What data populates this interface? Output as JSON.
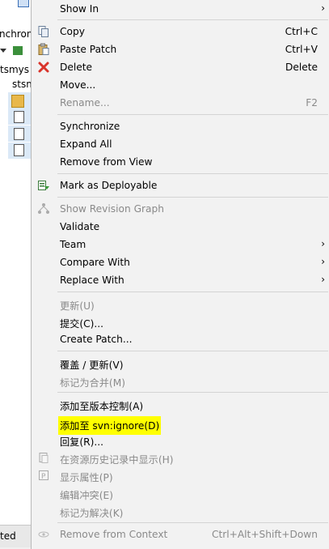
{
  "background": {
    "texts": [
      "nchroni",
      "tsmys",
      "stsm"
    ],
    "status_text": "ted"
  },
  "menu": {
    "items": [
      {
        "label": "Show In",
        "accel": "",
        "submenu": true,
        "disabled": false,
        "icon": "",
        "highlight": false
      },
      {
        "label": "Copy",
        "accel": "Ctrl+C",
        "submenu": false,
        "disabled": false,
        "icon": "copy-icon",
        "highlight": false
      },
      {
        "label": "Paste Patch",
        "accel": "Ctrl+V",
        "submenu": false,
        "disabled": false,
        "icon": "paste-icon",
        "highlight": false
      },
      {
        "label": "Delete",
        "accel": "Delete",
        "submenu": false,
        "disabled": false,
        "icon": "delete-icon",
        "highlight": false
      },
      {
        "label": "Move...",
        "accel": "",
        "submenu": false,
        "disabled": false,
        "icon": "",
        "highlight": false
      },
      {
        "label": "Rename...",
        "accel": "F2",
        "submenu": false,
        "disabled": true,
        "icon": "",
        "highlight": false
      },
      {
        "label": "Synchronize",
        "accel": "",
        "submenu": false,
        "disabled": false,
        "icon": "",
        "highlight": false
      },
      {
        "label": "Expand All",
        "accel": "",
        "submenu": false,
        "disabled": false,
        "icon": "",
        "highlight": false
      },
      {
        "label": "Remove from View",
        "accel": "",
        "submenu": false,
        "disabled": false,
        "icon": "",
        "highlight": false
      },
      {
        "label": "Mark as Deployable",
        "accel": "",
        "submenu": false,
        "disabled": false,
        "icon": "deploy-icon",
        "highlight": false
      },
      {
        "label": "Show Revision Graph",
        "accel": "",
        "submenu": false,
        "disabled": true,
        "icon": "revision-graph-icon",
        "highlight": false
      },
      {
        "label": "Validate",
        "accel": "",
        "submenu": false,
        "disabled": false,
        "icon": "",
        "highlight": false
      },
      {
        "label": "Team",
        "accel": "",
        "submenu": true,
        "disabled": false,
        "icon": "",
        "highlight": false
      },
      {
        "label": "Compare With",
        "accel": "",
        "submenu": true,
        "disabled": false,
        "icon": "",
        "highlight": false
      },
      {
        "label": "Replace With",
        "accel": "",
        "submenu": true,
        "disabled": false,
        "icon": "",
        "highlight": false
      },
      {
        "label": "更新(U)",
        "accel": "",
        "submenu": false,
        "disabled": true,
        "icon": "",
        "highlight": false
      },
      {
        "label": "提交(C)...",
        "accel": "",
        "submenu": false,
        "disabled": false,
        "icon": "",
        "highlight": false
      },
      {
        "label": "Create Patch...",
        "accel": "",
        "submenu": false,
        "disabled": false,
        "icon": "",
        "highlight": false
      },
      {
        "label": "覆盖 / 更新(V)",
        "accel": "",
        "submenu": false,
        "disabled": false,
        "icon": "",
        "highlight": false
      },
      {
        "label": "标记为合并(M)",
        "accel": "",
        "submenu": false,
        "disabled": true,
        "icon": "",
        "highlight": false
      },
      {
        "label": "添加至版本控制(A)",
        "accel": "",
        "submenu": false,
        "disabled": false,
        "icon": "",
        "highlight": false
      },
      {
        "label": "添加至 svn:ignore(D)",
        "accel": "",
        "submenu": false,
        "disabled": false,
        "icon": "",
        "highlight": true
      },
      {
        "label": "回复(R)...",
        "accel": "",
        "submenu": false,
        "disabled": false,
        "icon": "",
        "highlight": false
      },
      {
        "label": "在资源历史记录中显示(H)",
        "accel": "",
        "submenu": false,
        "disabled": true,
        "icon": "history-icon",
        "highlight": false
      },
      {
        "label": "显示属性(P)",
        "accel": "",
        "submenu": false,
        "disabled": true,
        "icon": "properties-icon",
        "highlight": false
      },
      {
        "label": "编辑冲突(E)",
        "accel": "",
        "submenu": false,
        "disabled": true,
        "icon": "",
        "highlight": false
      },
      {
        "label": "标记为解决(K)",
        "accel": "",
        "submenu": false,
        "disabled": true,
        "icon": "",
        "highlight": false
      },
      {
        "label": "Remove from Context",
        "accel": "Ctrl+Alt+Shift+Down",
        "submenu": false,
        "disabled": true,
        "icon": "remove-context-icon",
        "highlight": false
      }
    ],
    "submenu_arrow": "›",
    "colors": {
      "highlight": "#ffff00",
      "disabled_text": "#8a8a8a",
      "delete_icon": "#d9342b"
    }
  }
}
